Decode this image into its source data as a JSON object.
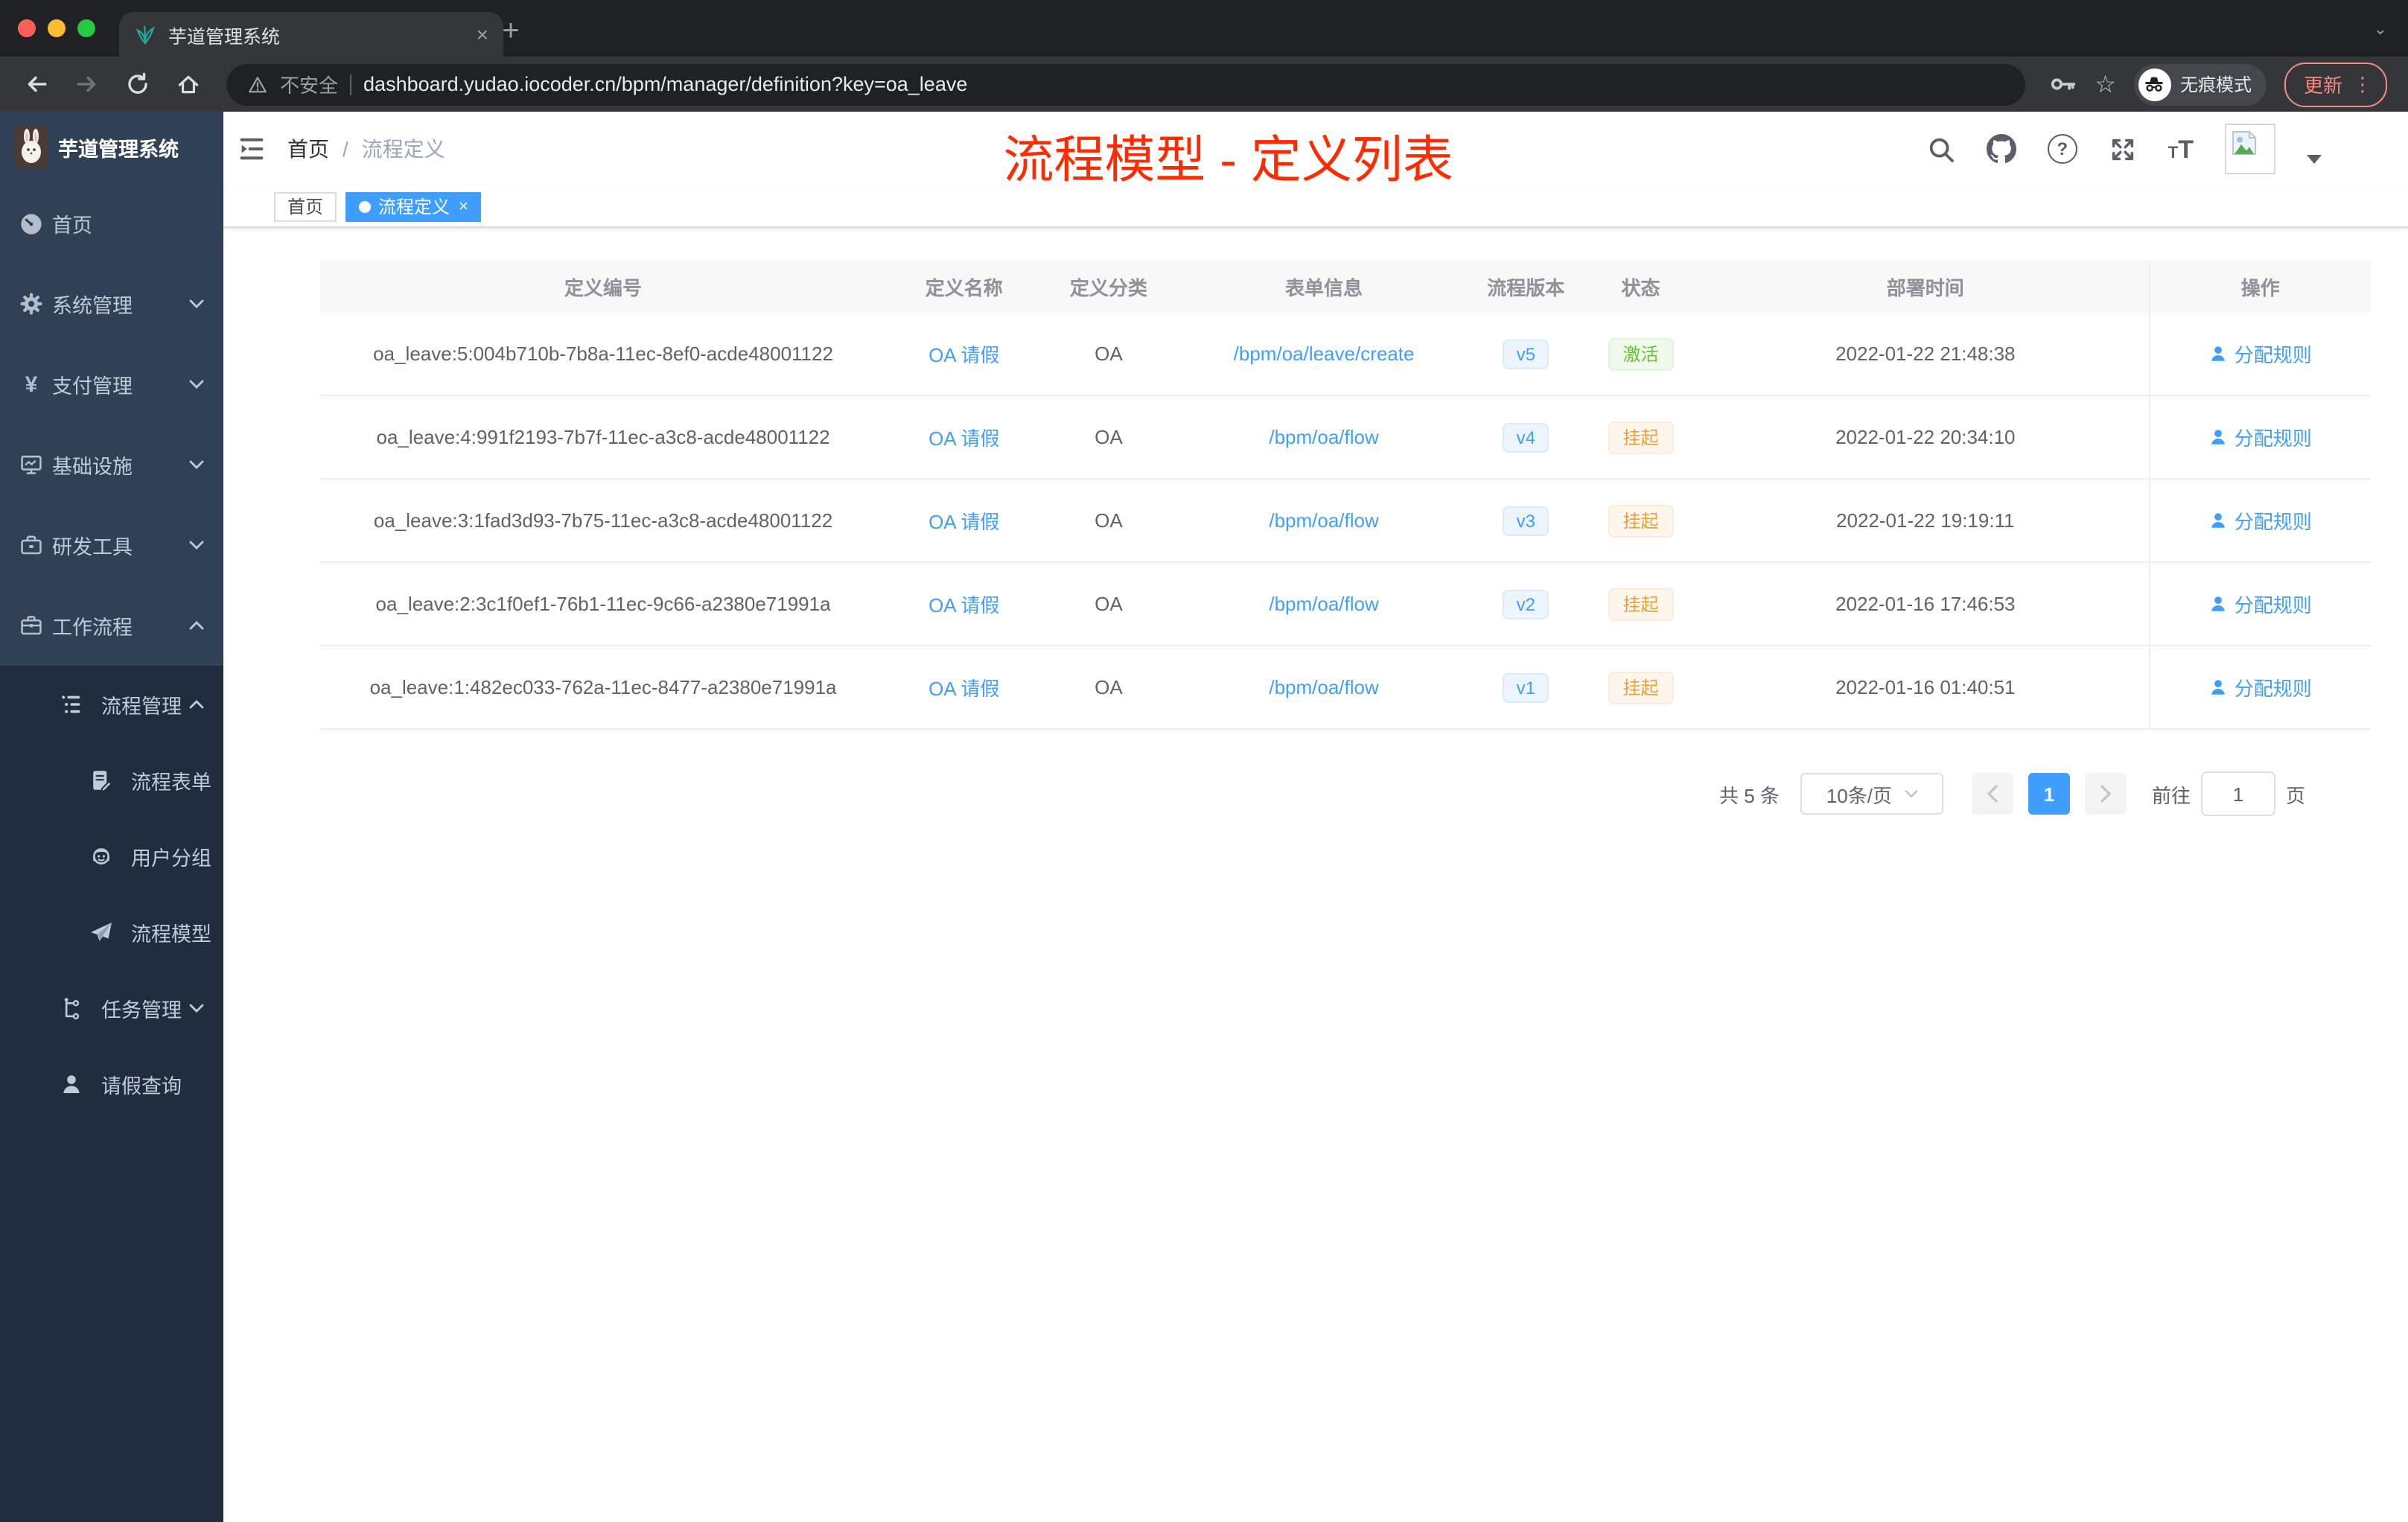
{
  "browser": {
    "tab_title": "芋道管理系统",
    "new_tab_glyph": "+",
    "tab_close_glyph": "×",
    "strip_caret_glyph": "⌄",
    "security_label": "不安全",
    "url": "dashboard.yudao.iocoder.cn/bpm/manager/definition?key=oa_leave",
    "star_glyph": "☆",
    "incognito_label": "无痕模式",
    "update_button": "更新",
    "kebab_glyph": "⋮"
  },
  "annotation": {
    "title": "流程模型 - 定义列表",
    "color": "#fe2b00"
  },
  "sidebar": {
    "logo_title": "芋道管理系统",
    "items": [
      {
        "label": "首页",
        "icon": "dashboard-icon",
        "level": 1
      },
      {
        "label": "系统管理",
        "icon": "gear-icon",
        "level": 1,
        "arrow": "down"
      },
      {
        "label": "支付管理",
        "icon": "yen-icon",
        "glyph": "¥",
        "level": 1,
        "arrow": "down"
      },
      {
        "label": "基础设施",
        "icon": "monitor-icon",
        "level": 1,
        "arrow": "down"
      },
      {
        "label": "研发工具",
        "icon": "toolbox-icon",
        "level": 1,
        "arrow": "down"
      },
      {
        "label": "工作流程",
        "icon": "briefcase-icon",
        "level": 1,
        "arrow": "up"
      },
      {
        "label": "流程管理",
        "icon": "tree-list-icon",
        "level": 2,
        "arrow": "up"
      },
      {
        "label": "流程表单",
        "icon": "form-icon",
        "level": 3
      },
      {
        "label": "用户分组",
        "icon": "robot-icon",
        "level": 3
      },
      {
        "label": "流程模型",
        "icon": "paper-plane-icon",
        "level": 3
      },
      {
        "label": "任务管理",
        "icon": "flow-icon",
        "level": 2,
        "arrow": "down"
      },
      {
        "label": "请假查询",
        "icon": "user-icon",
        "level": 2
      }
    ]
  },
  "header": {
    "breadcrumb": [
      "首页",
      "流程定义"
    ],
    "separator": "/",
    "help_glyph": "?",
    "font_icon_small": "T",
    "font_icon_big": "T"
  },
  "tags": [
    {
      "label": "首页",
      "active": false
    },
    {
      "label": "流程定义",
      "active": true,
      "close_glyph": "×"
    }
  ],
  "table": {
    "columns": [
      "定义编号",
      "定义名称",
      "定义分类",
      "表单信息",
      "流程版本",
      "状态",
      "部署时间",
      "操作"
    ],
    "rows": [
      {
        "id": "oa_leave:5:004b710b-7b8a-11ec-8ef0-acde48001122",
        "name": "OA 请假",
        "category": "OA",
        "form": "/bpm/oa/leave/create",
        "version": "v5",
        "status": "激活",
        "status_type": "success",
        "deploy_time": "2022-01-22 21:48:38",
        "action": "分配规则"
      },
      {
        "id": "oa_leave:4:991f2193-7b7f-11ec-a3c8-acde48001122",
        "name": "OA 请假",
        "category": "OA",
        "form": "/bpm/oa/flow",
        "version": "v4",
        "status": "挂起",
        "status_type": "warning",
        "deploy_time": "2022-01-22 20:34:10",
        "action": "分配规则"
      },
      {
        "id": "oa_leave:3:1fad3d93-7b75-11ec-a3c8-acde48001122",
        "name": "OA 请假",
        "category": "OA",
        "form": "/bpm/oa/flow",
        "version": "v3",
        "status": "挂起",
        "status_type": "warning",
        "deploy_time": "2022-01-22 19:19:11",
        "action": "分配规则"
      },
      {
        "id": "oa_leave:2:3c1f0ef1-76b1-11ec-9c66-a2380e71991a",
        "name": "OA 请假",
        "category": "OA",
        "form": "/bpm/oa/flow",
        "version": "v2",
        "status": "挂起",
        "status_type": "warning",
        "deploy_time": "2022-01-16 17:46:53",
        "action": "分配规则"
      },
      {
        "id": "oa_leave:1:482ec033-762a-11ec-8477-a2380e71991a",
        "name": "OA 请假",
        "category": "OA",
        "form": "/bpm/oa/flow",
        "version": "v1",
        "status": "挂起",
        "status_type": "warning",
        "deploy_time": "2022-01-16 01:40:51",
        "action": "分配规则"
      }
    ]
  },
  "pagination": {
    "total_label": "共 5 条",
    "page_size": "10条/页",
    "current_page": "1",
    "goto_label": "前往",
    "goto_value": "1",
    "page_unit": "页"
  },
  "colors": {
    "accent": "#409eff",
    "success": "#67c23a",
    "warning": "#e6a23c",
    "sidebar": "#304156",
    "submenu": "#1f2d3d",
    "tag_active": "#409eff"
  }
}
